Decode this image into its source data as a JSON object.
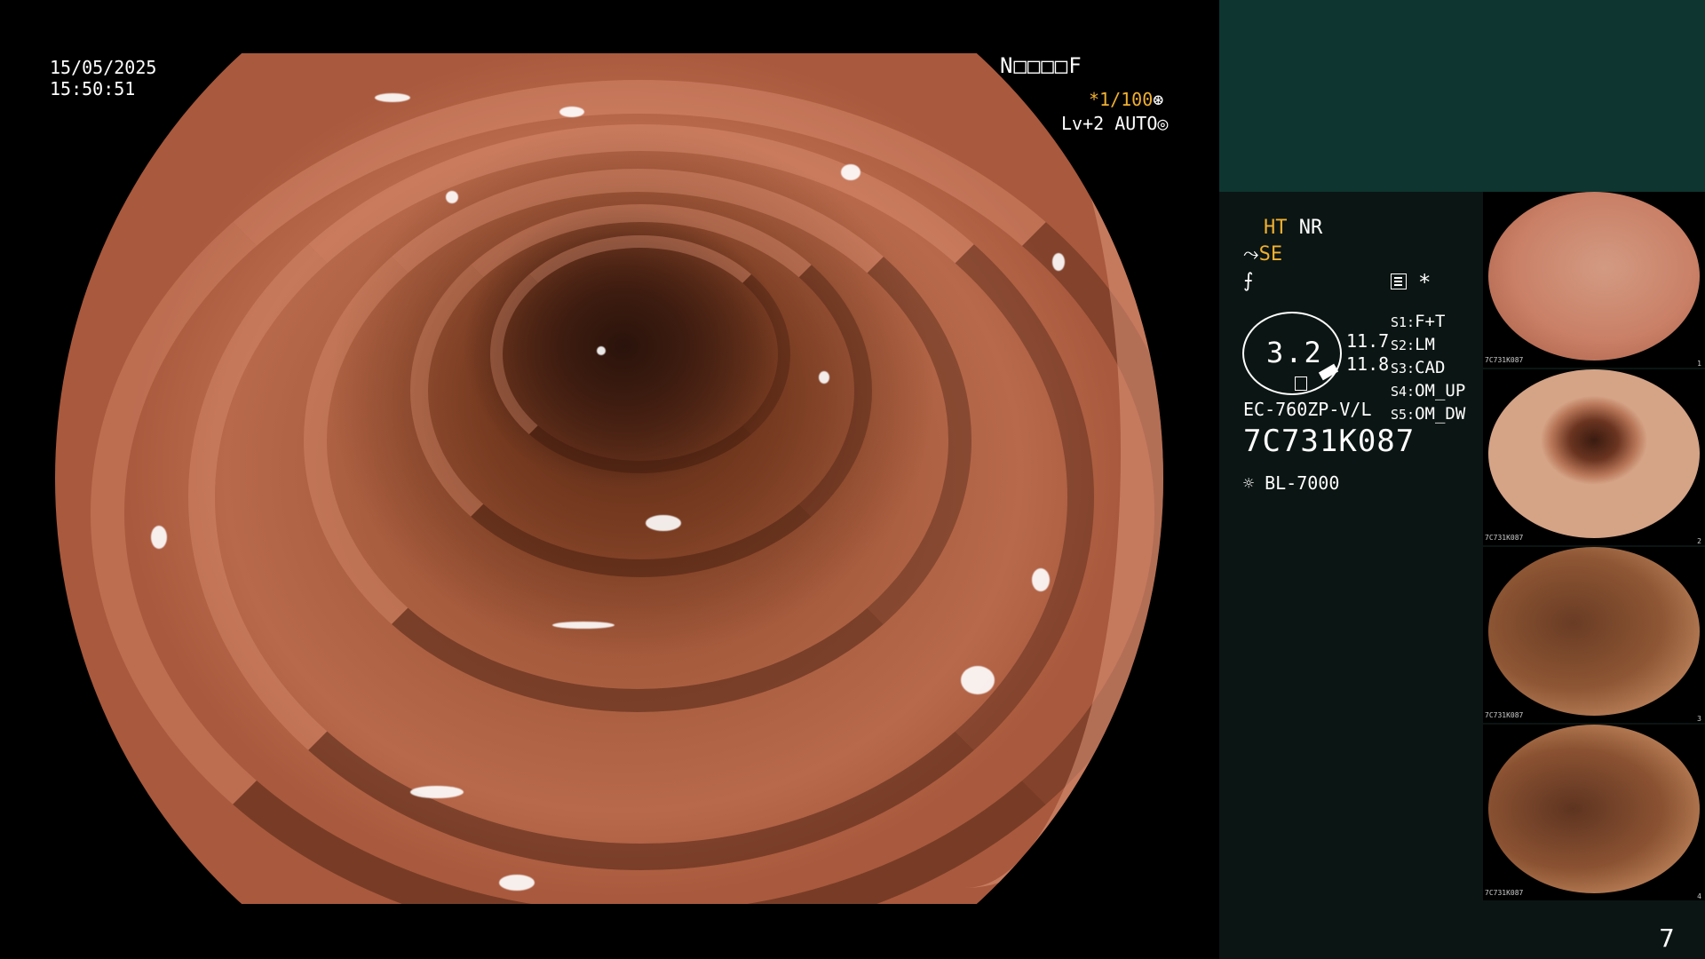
{
  "overlay": {
    "date": "15/05/2025",
    "time": "15:50:51",
    "patient_id": "N□□□□F",
    "shutter": "*1/100",
    "shutter_icon": "aperture-icon",
    "level": "Lv+2 AUTO",
    "level_icon": "iris-icon"
  },
  "settings": {
    "ht": "HT",
    "nr": "NR",
    "se": "SE",
    "zoom": "3.2",
    "ratio_1": "11.7",
    "ratio_2": "11.8",
    "presets": [
      {
        "key": "S1:",
        "value": "F+T"
      },
      {
        "key": "S2:",
        "value": "LM"
      },
      {
        "key": "S3:",
        "value": "CAD"
      },
      {
        "key": "S4:",
        "value": "OM_UP"
      },
      {
        "key": "S5:",
        "value": "OM_DW"
      }
    ],
    "star": "*",
    "scope_model": "EC-760ZP-V/L",
    "scope_serial": "7C731K087",
    "light_source": "BL-7000",
    "accent_color": "#f0b030"
  },
  "thumbnails": [
    {
      "label": "7C731K087",
      "num": "1"
    },
    {
      "label": "7C731K087",
      "num": "2"
    },
    {
      "label": "7C731K087",
      "num": "3"
    },
    {
      "label": "7C731K087",
      "num": "4"
    }
  ],
  "page_number": "7"
}
